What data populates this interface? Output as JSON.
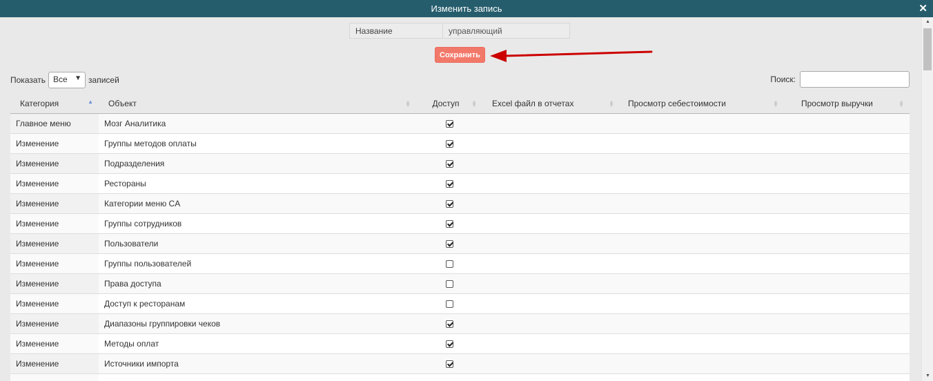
{
  "dialog": {
    "title": "Изменить запись",
    "close_symbol": "✕"
  },
  "form": {
    "name_label": "Название",
    "name_value": "управляющий",
    "save_label": "Сохранить"
  },
  "annotation": {
    "arrow_color": "#cc0000"
  },
  "length_control": {
    "show_label": "Показать",
    "selected": "Все",
    "records_label": "записей"
  },
  "search": {
    "label": "Поиск:",
    "value": ""
  },
  "table": {
    "columns": [
      "Категория",
      "Объект",
      "Доступ",
      "Excel файл в отчетах",
      "Просмотр себестоимости",
      "Просмотр выручки"
    ],
    "rows": [
      {
        "category": "Главное меню",
        "object": "Мозг Аналитика",
        "access": true
      },
      {
        "category": "Изменение",
        "object": "Группы методов оплаты",
        "access": true
      },
      {
        "category": "Изменение",
        "object": "Подразделения",
        "access": true
      },
      {
        "category": "Изменение",
        "object": "Рестораны",
        "access": true
      },
      {
        "category": "Изменение",
        "object": "Категории меню CA",
        "access": true
      },
      {
        "category": "Изменение",
        "object": "Группы сотрудников",
        "access": true
      },
      {
        "category": "Изменение",
        "object": "Пользователи",
        "access": true
      },
      {
        "category": "Изменение",
        "object": "Группы пользователей",
        "access": false
      },
      {
        "category": "Изменение",
        "object": "Права доступа",
        "access": false
      },
      {
        "category": "Изменение",
        "object": "Доступ к ресторанам",
        "access": false
      },
      {
        "category": "Изменение",
        "object": "Диапазоны группировки чеков",
        "access": true
      },
      {
        "category": "Изменение",
        "object": "Методы оплат",
        "access": true
      },
      {
        "category": "Изменение",
        "object": "Источники импорта",
        "access": true
      },
      {
        "category": "",
        "object": "",
        "access": null
      }
    ]
  },
  "colors": {
    "titlebar": "#265d6d",
    "save_button": "#f2796a"
  }
}
